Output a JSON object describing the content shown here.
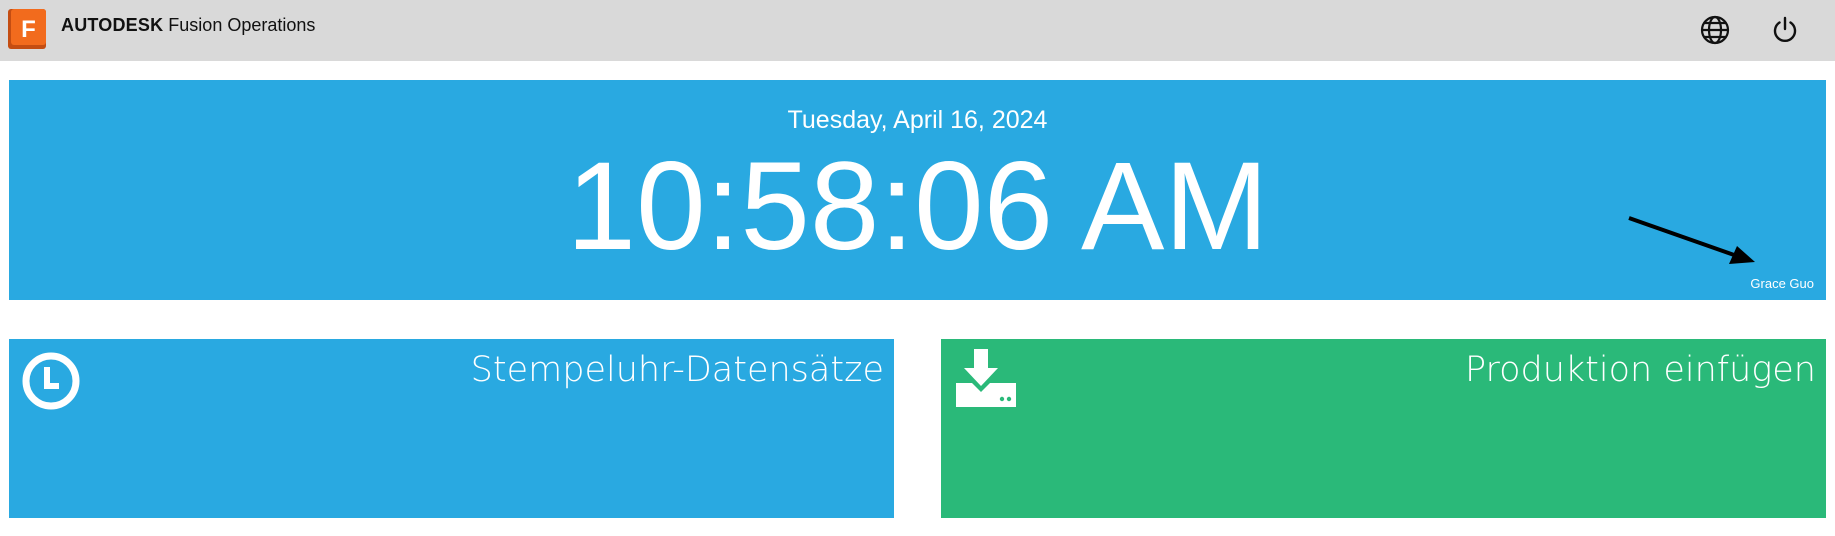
{
  "header": {
    "brand_name": "AUTODESK",
    "product_name": "Fusion Operations",
    "logo_letter": "F",
    "icons": [
      "globe-icon",
      "power-icon"
    ]
  },
  "clock": {
    "date": "Tuesday, April 16, 2024",
    "time": "10:58:06 AM",
    "user": "Grace Guo",
    "background": "#29a9e1"
  },
  "tiles": [
    {
      "label": "Stempeluhr-Datensätze",
      "icon": "clock-icon",
      "color": "#29a9e1"
    },
    {
      "label": "Produktion einfügen",
      "icon": "download-icon",
      "color": "#2ab979"
    }
  ],
  "colors": {
    "topbar": "#d9d9d9",
    "logo_orange": "#f26b1d"
  }
}
